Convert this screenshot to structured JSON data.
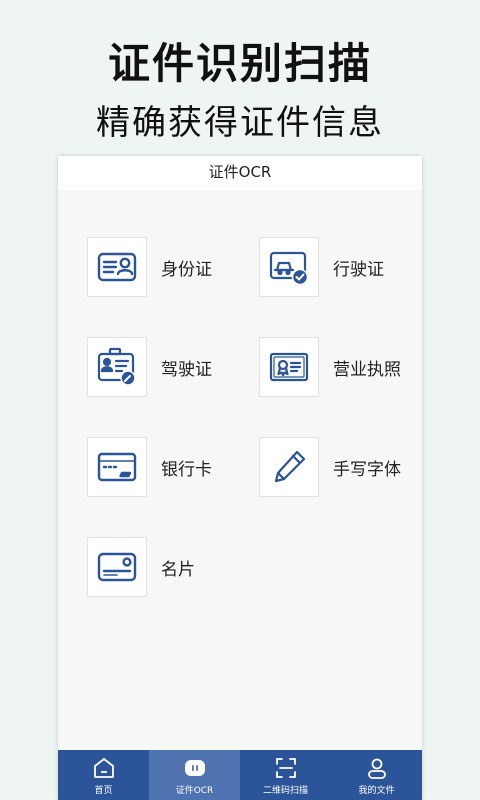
{
  "promo": {
    "title": "证件识别扫描",
    "subtitle": "精确获得证件信息"
  },
  "app": {
    "title": "证件OCR",
    "items": [
      {
        "label": "身份证",
        "icon": "id-card-icon"
      },
      {
        "label": "行驶证",
        "icon": "vehicle-license-icon"
      },
      {
        "label": "驾驶证",
        "icon": "driver-license-icon"
      },
      {
        "label": "营业执照",
        "icon": "business-license-icon"
      },
      {
        "label": "银行卡",
        "icon": "bank-card-icon"
      },
      {
        "label": "手写字体",
        "icon": "handwriting-icon"
      },
      {
        "label": "名片",
        "icon": "business-card-icon"
      }
    ],
    "tabs": [
      {
        "label": "首页",
        "icon": "home-icon",
        "active": false
      },
      {
        "label": "证件OCR",
        "icon": "ocr-icon",
        "active": true
      },
      {
        "label": "二维码扫描",
        "icon": "qr-scan-icon",
        "active": false
      },
      {
        "label": "我的文件",
        "icon": "profile-icon",
        "active": false
      }
    ]
  },
  "colors": {
    "background": "#eef5f2",
    "tabbar": "#2c5498",
    "tab_active": "#4f72b0",
    "icon_stroke": "#2c5498"
  }
}
